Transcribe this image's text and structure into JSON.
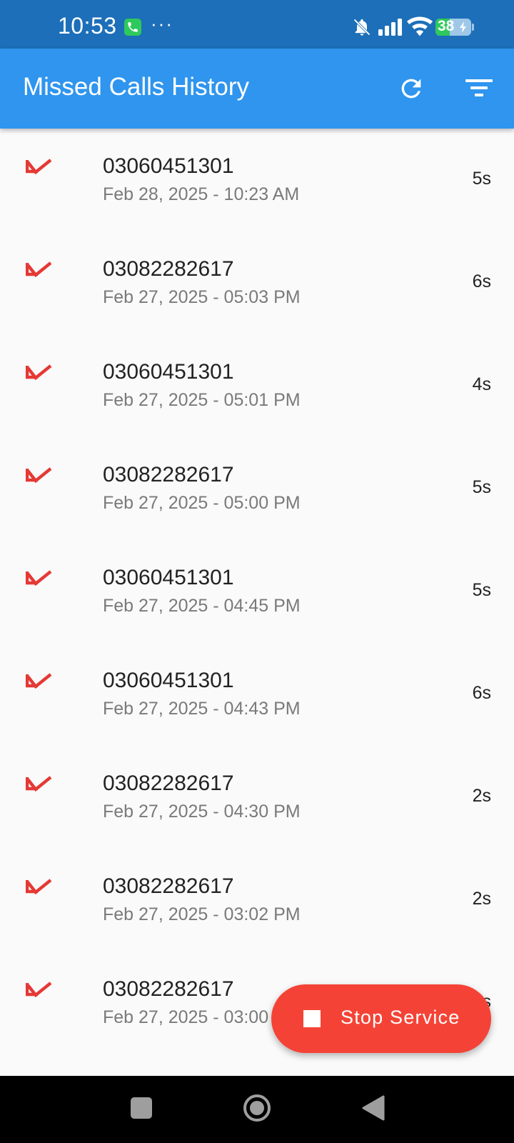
{
  "status_bar": {
    "time": "10:53",
    "more_indicator": "···",
    "battery_level": "38",
    "icons": [
      "phone-call-notification-icon",
      "bell-muted-icon",
      "signal-icon",
      "wifi-icon",
      "battery-charging-icon"
    ]
  },
  "app_bar": {
    "title": "Missed Calls History",
    "actions": [
      "refresh-icon",
      "filter-icon"
    ]
  },
  "calls": [
    {
      "number": "03060451301",
      "datetime": "Feb 28, 2025 - 10:23 AM",
      "duration": "5s"
    },
    {
      "number": "03082282617",
      "datetime": "Feb 27, 2025 - 05:03 PM",
      "duration": "6s"
    },
    {
      "number": "03060451301",
      "datetime": "Feb 27, 2025 - 05:01 PM",
      "duration": "4s"
    },
    {
      "number": "03082282617",
      "datetime": "Feb 27, 2025 - 05:00 PM",
      "duration": "5s"
    },
    {
      "number": "03060451301",
      "datetime": "Feb 27, 2025 - 04:45 PM",
      "duration": "5s"
    },
    {
      "number": "03060451301",
      "datetime": "Feb 27, 2025 - 04:43 PM",
      "duration": "6s"
    },
    {
      "number": "03082282617",
      "datetime": "Feb 27, 2025 - 04:30 PM",
      "duration": "2s"
    },
    {
      "number": "03082282617",
      "datetime": "Feb 27, 2025 - 03:02 PM",
      "duration": "2s"
    },
    {
      "number": "03082282617",
      "datetime": "Feb 27, 2025 - 03:00 PM",
      "duration": "5s"
    }
  ],
  "fab": {
    "label": "Stop Service",
    "icon": "stop-icon"
  },
  "colors": {
    "status_bar": "#1c6fb8",
    "app_bar": "#2f95ee",
    "missed_call_icon": "#e53935",
    "fab": "#f44336"
  }
}
